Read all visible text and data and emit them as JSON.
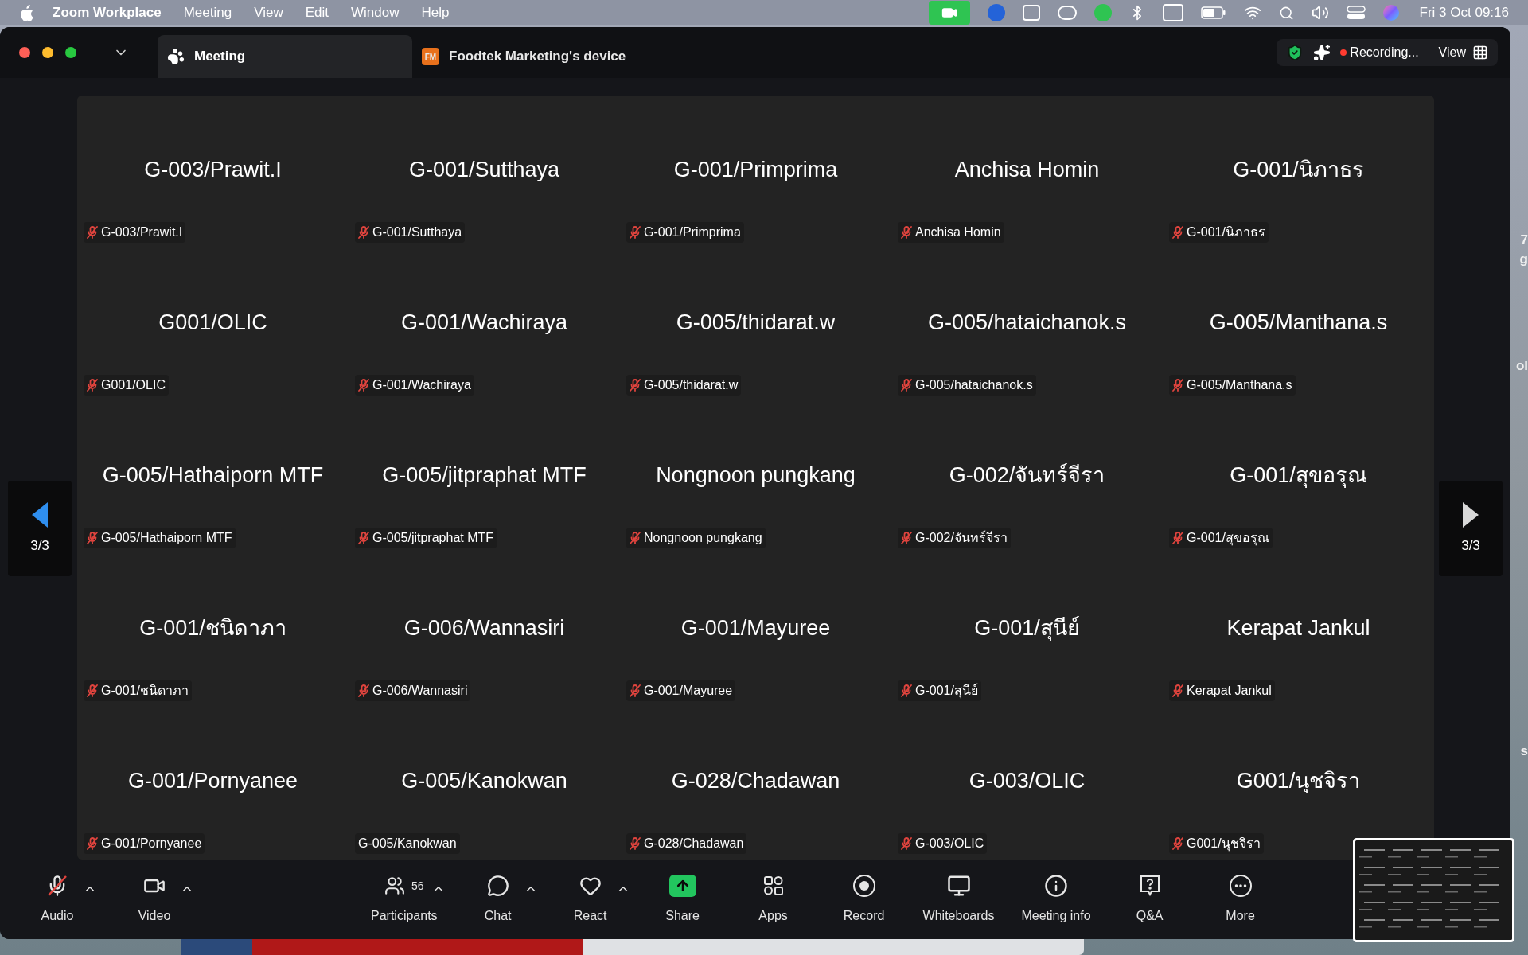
{
  "menu_bar": {
    "app_name": "Zoom Workplace",
    "menus": [
      "Meeting",
      "View",
      "Edit",
      "Window",
      "Help"
    ],
    "clock": "Fri 3 Oct 09:16"
  },
  "window": {
    "tabs": [
      {
        "label": "Meeting",
        "selected": true,
        "kind": "meeting"
      },
      {
        "label": "Foodtek Marketing's device",
        "selected": false,
        "kind": "device",
        "badge": "FM"
      }
    ],
    "recording": "Recording...",
    "view_button": "View"
  },
  "gallery": {
    "page_left": "3/3",
    "page_right": "3/3",
    "tiles": [
      {
        "name": "G-003/Prawit.I",
        "label": "G-003/Prawit.I",
        "muted": true
      },
      {
        "name": "G-001/Sutthaya",
        "label": "G-001/Sutthaya",
        "muted": true
      },
      {
        "name": "G-001/Primprima",
        "label": "G-001/Primprima",
        "muted": true
      },
      {
        "name": "Anchisa Homin",
        "label": "Anchisa Homin",
        "muted": true
      },
      {
        "name": "G-001/นิภาธร",
        "label": "G-001/นิภาธร",
        "muted": true
      },
      {
        "name": "G001/OLIC",
        "label": "G001/OLIC",
        "muted": true
      },
      {
        "name": "G-001/Wachiraya",
        "label": "G-001/Wachiraya",
        "muted": true
      },
      {
        "name": "G-005/thidarat.w",
        "label": "G-005/thidarat.w",
        "muted": true
      },
      {
        "name": "G-005/hataichanok.s",
        "label": "G-005/hataichanok.s",
        "muted": true
      },
      {
        "name": "G-005/Manthana.s",
        "label": "G-005/Manthana.s",
        "muted": true
      },
      {
        "name": "G-005/Hathaiporn MTF",
        "label": "G-005/Hathaiporn MTF",
        "muted": true
      },
      {
        "name": "G-005/jitpraphat MTF",
        "label": "G-005/jitpraphat MTF",
        "muted": true
      },
      {
        "name": "Nongnoon pungkang",
        "label": "Nongnoon pungkang",
        "muted": true
      },
      {
        "name": "G-002/จันทร์จีรา",
        "label": "G-002/จันทร์จีรา",
        "muted": true
      },
      {
        "name": "G-001/สุขอรุณ",
        "label": "G-001/สุขอรุณ",
        "muted": true
      },
      {
        "name": "G-001/ชนิดาภา",
        "label": "G-001/ชนิดาภา",
        "muted": true
      },
      {
        "name": "G-006/Wannasiri",
        "label": "G-006/Wannasiri",
        "muted": true
      },
      {
        "name": "G-001/Mayuree",
        "label": "G-001/Mayuree",
        "muted": true
      },
      {
        "name": "G-001/สุนีย์",
        "label": "G-001/สุนีย์",
        "muted": true
      },
      {
        "name": "Kerapat Jankul",
        "label": "Kerapat Jankul",
        "muted": true
      },
      {
        "name": "G-001/Pornyanee",
        "label": "G-001/Pornyanee",
        "muted": true
      },
      {
        "name": "G-005/Kanokwan",
        "label": "G-005/Kanokwan",
        "muted": false
      },
      {
        "name": "G-028/Chadawan",
        "label": "G-028/Chadawan",
        "muted": true
      },
      {
        "name": "G-003/OLIC",
        "label": "G-003/OLIC",
        "muted": true
      },
      {
        "name": "G001/นุชจิรา",
        "label": "G001/นุชจิรา",
        "muted": true
      }
    ]
  },
  "toolbar": [
    {
      "kind": "audio",
      "label": "Audio",
      "caret": true,
      "muted": true
    },
    {
      "kind": "video",
      "label": "Video",
      "caret": true
    },
    {
      "kind": "participants",
      "label": "Participants",
      "caret": true,
      "count": "56"
    },
    {
      "kind": "chat",
      "label": "Chat",
      "caret": true
    },
    {
      "kind": "react",
      "label": "React",
      "caret": true
    },
    {
      "kind": "share",
      "label": "Share",
      "caret": false
    },
    {
      "kind": "apps",
      "label": "Apps",
      "caret": false
    },
    {
      "kind": "record",
      "label": "Record",
      "caret": false
    },
    {
      "kind": "whiteboards",
      "label": "Whiteboards",
      "caret": false
    },
    {
      "kind": "info",
      "label": "Meeting info",
      "caret": false
    },
    {
      "kind": "qa",
      "label": "Q&A",
      "caret": false
    },
    {
      "kind": "more",
      "label": "More",
      "caret": false
    }
  ],
  "desktop_edge_texts": [
    "7",
    "g",
    "ol",
    "s"
  ]
}
